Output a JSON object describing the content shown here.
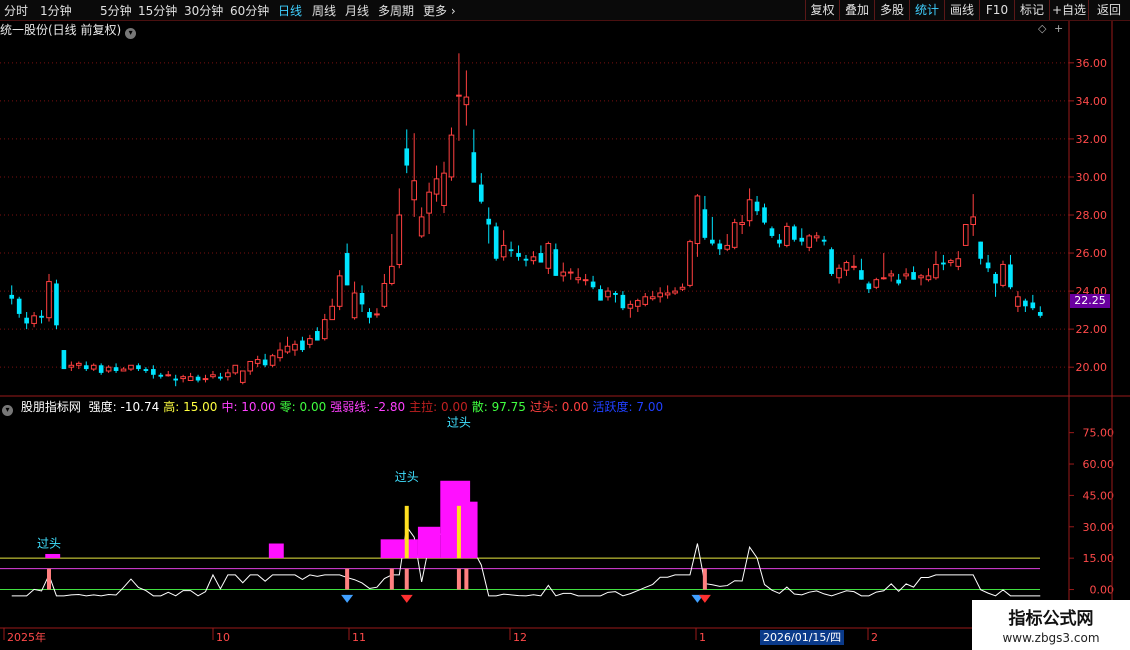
{
  "toolbar": {
    "periods": [
      "分时",
      "1分钟",
      "5分钟",
      "15分钟",
      "30分钟",
      "60分钟",
      "日线",
      "周线",
      "月线",
      "多周期",
      "更多"
    ],
    "active_period": "日线",
    "right_buttons": [
      "复权",
      "叠加",
      "多股",
      "统计",
      "画线",
      "F10",
      "标记",
      "+自选",
      "返回"
    ],
    "active_right": "统计"
  },
  "main_panel": {
    "title": "统一股份(日线 前复权)",
    "price_axis_labels": [
      "36.00",
      "34.00",
      "32.00",
      "30.00",
      "28.00",
      "26.00",
      "24.00",
      "22.00",
      "20.00"
    ],
    "last_price_tag": "22.25"
  },
  "indicator": {
    "name": "股朋指标网",
    "items": [
      {
        "label": "强度: -10.74",
        "color": "#ffffff"
      },
      {
        "label": "高: 15.00",
        "color": "#ffff40"
      },
      {
        "label": "中: 10.00",
        "color": "#ff40ff"
      },
      {
        "label": "零: 0.00",
        "color": "#40ff40"
      },
      {
        "label": "强弱线: -2.80",
        "color": "#ff40ff"
      },
      {
        "label": "主拉: 0.00",
        "color": "#c02020"
      },
      {
        "label": "散: 97.75",
        "color": "#40ff40"
      },
      {
        "label": "过头: 0.00",
        "color": "#ff4040"
      },
      {
        "label": "活跃度: 7.00",
        "color": "#2040ff"
      }
    ],
    "axis_labels": [
      "75.00",
      "60.00",
      "45.00",
      "30.00",
      "15.00",
      "0.00"
    ],
    "annotations": [
      "过头",
      "过头",
      "过头"
    ]
  },
  "time_axis": {
    "labels": [
      "2025年",
      "10",
      "11",
      "12",
      "1",
      "2"
    ],
    "cursor_date": "2026/01/15/四"
  },
  "watermark": {
    "line1": "指标公式网",
    "line2": "www.zbgs3.com"
  },
  "colors": {
    "up": "#ff4040",
    "down": "#00e5ff",
    "grid": "#7a1010",
    "axis": "#9a1a1a"
  },
  "chart_data": {
    "type": "candlestick",
    "ylim": [
      18.8,
      37.2
    ],
    "candles": [
      [
        23.8,
        24.3,
        23.3,
        23.6
      ],
      [
        23.6,
        23.7,
        22.6,
        22.8
      ],
      [
        22.6,
        22.9,
        22.0,
        22.3
      ],
      [
        22.3,
        22.9,
        22.1,
        22.7
      ],
      [
        22.7,
        23.0,
        22.3,
        22.6
      ],
      [
        22.6,
        24.9,
        22.4,
        24.5
      ],
      [
        24.4,
        24.6,
        22.0,
        22.2
      ],
      [
        20.9,
        20.9,
        19.9,
        19.9
      ],
      [
        20.0,
        20.3,
        19.8,
        20.1
      ],
      [
        20.1,
        20.3,
        19.9,
        20.2
      ],
      [
        20.1,
        20.3,
        19.8,
        19.9
      ],
      [
        19.9,
        20.2,
        19.8,
        20.1
      ],
      [
        20.1,
        20.2,
        19.6,
        19.7
      ],
      [
        19.8,
        20.1,
        19.7,
        20.0
      ],
      [
        20.0,
        20.2,
        19.7,
        19.8
      ],
      [
        19.8,
        20.0,
        19.8,
        19.9
      ],
      [
        19.9,
        20.1,
        19.8,
        20.1
      ],
      [
        20.1,
        20.2,
        19.8,
        19.9
      ],
      [
        19.9,
        20.0,
        19.7,
        19.8
      ],
      [
        19.9,
        20.1,
        19.4,
        19.6
      ],
      [
        19.6,
        19.7,
        19.4,
        19.5
      ],
      [
        19.6,
        19.8,
        19.5,
        19.6
      ],
      [
        19.4,
        19.6,
        19.0,
        19.3
      ],
      [
        19.4,
        19.6,
        19.2,
        19.5
      ],
      [
        19.3,
        19.7,
        19.3,
        19.5
      ],
      [
        19.5,
        19.6,
        19.2,
        19.3
      ],
      [
        19.4,
        19.6,
        19.2,
        19.4
      ],
      [
        19.5,
        19.8,
        19.4,
        19.6
      ],
      [
        19.5,
        19.7,
        19.3,
        19.4
      ],
      [
        19.5,
        19.9,
        19.3,
        19.7
      ],
      [
        19.7,
        20.1,
        19.6,
        20.1
      ],
      [
        19.2,
        19.8,
        19.1,
        19.8
      ],
      [
        19.8,
        20.3,
        19.6,
        20.3
      ],
      [
        20.2,
        20.6,
        20.0,
        20.4
      ],
      [
        20.4,
        20.7,
        20.0,
        20.1
      ],
      [
        20.1,
        20.7,
        20.0,
        20.6
      ],
      [
        20.5,
        21.3,
        20.3,
        20.9
      ],
      [
        20.8,
        21.6,
        20.7,
        21.1
      ],
      [
        20.9,
        21.4,
        20.6,
        21.2
      ],
      [
        21.4,
        21.6,
        20.8,
        20.9
      ],
      [
        21.2,
        21.7,
        21.0,
        21.5
      ],
      [
        21.9,
        22.1,
        21.4,
        21.4
      ],
      [
        21.5,
        22.8,
        21.4,
        22.5
      ],
      [
        22.5,
        23.6,
        22.5,
        23.2
      ],
      [
        23.2,
        25.1,
        23.0,
        24.8
      ],
      [
        26.0,
        26.5,
        24.3,
        24.3
      ],
      [
        22.6,
        24.5,
        22.5,
        23.9
      ],
      [
        23.9,
        24.3,
        22.9,
        23.3
      ],
      [
        22.9,
        23.1,
        22.3,
        22.6
      ],
      [
        22.8,
        23.1,
        22.6,
        22.8
      ],
      [
        23.2,
        24.9,
        23.1,
        24.4
      ],
      [
        24.4,
        27.0,
        24.3,
        25.3
      ],
      [
        25.4,
        29.4,
        25.2,
        28.0
      ],
      [
        31.5,
        32.5,
        30.2,
        30.6
      ],
      [
        28.8,
        32.3,
        27.9,
        29.8
      ],
      [
        26.9,
        28.4,
        26.8,
        27.9
      ],
      [
        28.1,
        29.7,
        27.0,
        29.2
      ],
      [
        29.1,
        30.6,
        28.7,
        29.9
      ],
      [
        28.5,
        30.8,
        28.1,
        30.2
      ],
      [
        30.0,
        32.6,
        29.8,
        32.2
      ],
      [
        34.3,
        36.5,
        31.9,
        34.3
      ],
      [
        33.8,
        35.6,
        32.7,
        34.2
      ],
      [
        31.3,
        32.5,
        30.4,
        29.7
      ],
      [
        29.6,
        30.2,
        28.6,
        28.7
      ],
      [
        27.8,
        28.4,
        26.5,
        27.5
      ],
      [
        27.4,
        27.6,
        25.6,
        25.7
      ],
      [
        25.8,
        27.2,
        25.6,
        26.4
      ],
      [
        26.2,
        26.6,
        25.8,
        26.1
      ],
      [
        26.0,
        26.4,
        25.6,
        25.8
      ],
      [
        25.7,
        25.9,
        25.3,
        25.6
      ],
      [
        25.6,
        26.1,
        25.4,
        25.8
      ],
      [
        26.0,
        26.4,
        25.5,
        25.5
      ],
      [
        25.2,
        26.6,
        24.9,
        26.5
      ],
      [
        26.2,
        26.5,
        24.8,
        24.8
      ],
      [
        24.8,
        25.5,
        24.5,
        25.0
      ],
      [
        25.0,
        25.2,
        24.6,
        25.0
      ],
      [
        24.6,
        25.2,
        24.4,
        24.7
      ],
      [
        24.6,
        24.9,
        24.3,
        24.6
      ],
      [
        24.5,
        24.8,
        24.1,
        24.2
      ],
      [
        24.1,
        24.3,
        23.5,
        23.5
      ],
      [
        23.7,
        24.2,
        23.5,
        24.0
      ],
      [
        23.9,
        24.0,
        23.4,
        23.8
      ],
      [
        23.8,
        24.0,
        23.0,
        23.1
      ],
      [
        23.1,
        23.5,
        22.6,
        23.3
      ],
      [
        23.2,
        23.6,
        22.9,
        23.5
      ],
      [
        23.3,
        23.9,
        23.2,
        23.7
      ],
      [
        23.6,
        24.0,
        23.5,
        23.7
      ],
      [
        23.7,
        24.2,
        23.4,
        23.9
      ],
      [
        23.8,
        24.3,
        23.6,
        23.9
      ],
      [
        23.9,
        24.2,
        23.8,
        24.0
      ],
      [
        24.1,
        24.4,
        24.0,
        24.2
      ],
      [
        24.3,
        26.7,
        24.2,
        26.6
      ],
      [
        26.5,
        29.1,
        25.8,
        29.0
      ],
      [
        28.3,
        29.0,
        26.7,
        26.8
      ],
      [
        26.7,
        27.9,
        26.4,
        26.5
      ],
      [
        26.5,
        26.7,
        25.9,
        26.2
      ],
      [
        26.2,
        27.0,
        26.1,
        26.4
      ],
      [
        26.3,
        27.8,
        26.2,
        27.6
      ],
      [
        27.5,
        28.0,
        27.0,
        27.6
      ],
      [
        27.7,
        29.4,
        27.4,
        28.8
      ],
      [
        28.7,
        29.0,
        28.0,
        28.2
      ],
      [
        28.4,
        28.6,
        27.5,
        27.6
      ],
      [
        27.3,
        27.4,
        26.8,
        26.9
      ],
      [
        26.7,
        27.0,
        26.3,
        26.5
      ],
      [
        26.4,
        27.6,
        26.3,
        27.4
      ],
      [
        27.4,
        27.5,
        26.6,
        26.7
      ],
      [
        26.8,
        27.3,
        26.4,
        26.6
      ],
      [
        26.3,
        27.0,
        26.1,
        26.9
      ],
      [
        26.8,
        27.1,
        26.6,
        26.9
      ],
      [
        26.7,
        26.9,
        26.4,
        26.6
      ],
      [
        26.2,
        26.3,
        24.8,
        24.9
      ],
      [
        24.7,
        25.4,
        24.4,
        25.2
      ],
      [
        25.1,
        25.6,
        24.8,
        25.5
      ],
      [
        25.3,
        25.9,
        25.1,
        25.3
      ],
      [
        25.1,
        25.7,
        24.6,
        24.6
      ],
      [
        24.4,
        24.5,
        23.9,
        24.1
      ],
      [
        24.2,
        24.7,
        24.1,
        24.6
      ],
      [
        24.7,
        26.0,
        24.6,
        24.7
      ],
      [
        24.8,
        25.1,
        24.5,
        24.9
      ],
      [
        24.6,
        24.9,
        24.3,
        24.4
      ],
      [
        24.8,
        25.2,
        24.6,
        24.9
      ],
      [
        25.0,
        25.3,
        24.6,
        24.6
      ],
      [
        24.7,
        24.9,
        24.3,
        24.8
      ],
      [
        24.6,
        25.2,
        24.5,
        24.8
      ],
      [
        24.7,
        26.1,
        24.6,
        25.4
      ],
      [
        25.5,
        25.9,
        25.1,
        25.4
      ],
      [
        25.5,
        25.7,
        25.3,
        25.6
      ],
      [
        25.3,
        26.1,
        25.1,
        25.7
      ],
      [
        26.4,
        27.3,
        26.4,
        27.5
      ],
      [
        27.5,
        29.1,
        26.9,
        27.9
      ],
      [
        26.6,
        26.6,
        25.4,
        25.7
      ],
      [
        25.5,
        25.9,
        25.0,
        25.2
      ],
      [
        24.9,
        25.0,
        23.7,
        24.4
      ],
      [
        24.3,
        25.6,
        24.2,
        25.4
      ],
      [
        25.4,
        25.9,
        24.1,
        24.2
      ],
      [
        23.2,
        24.0,
        22.9,
        23.7
      ],
      [
        23.5,
        23.6,
        22.9,
        23.2
      ],
      [
        23.4,
        23.8,
        23.0,
        23.1
      ],
      [
        22.9,
        23.2,
        22.6,
        22.7
      ]
    ]
  }
}
